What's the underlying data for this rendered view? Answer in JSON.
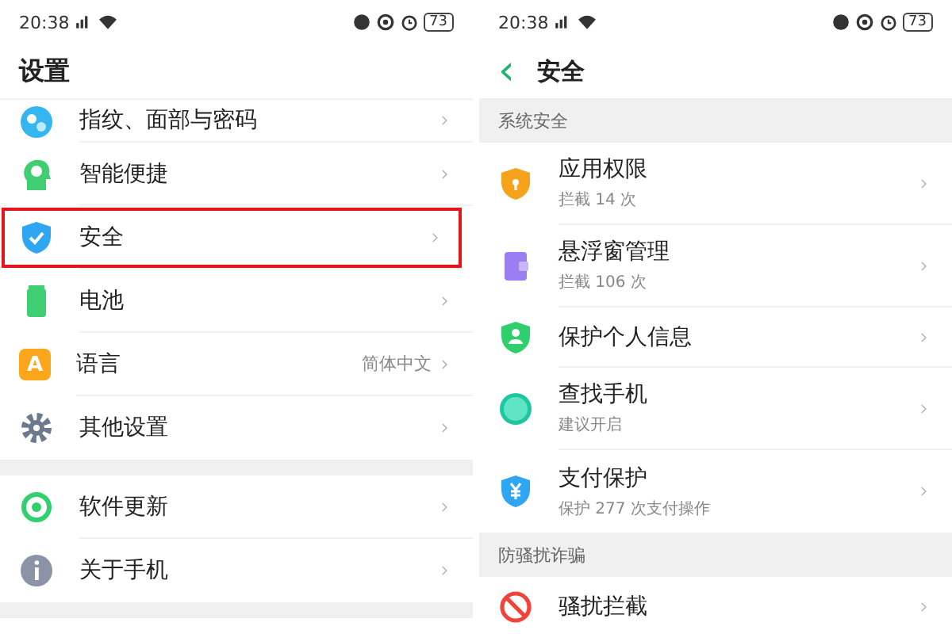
{
  "left_screen": {
    "status_bar": {
      "time": "20:38",
      "battery": "73"
    },
    "title": "设置",
    "groups": [
      {
        "items": [
          {
            "label": "指纹、面部与密码",
            "highlighted": false
          },
          {
            "label": "智能便捷",
            "highlighted": false
          },
          {
            "label": "安全",
            "highlighted": true
          },
          {
            "label": "电池",
            "highlighted": false
          },
          {
            "label": "语言",
            "value": "简体中文",
            "icon_text": "A",
            "highlighted": false
          },
          {
            "label": "其他设置",
            "highlighted": false
          }
        ]
      },
      {
        "items": [
          {
            "label": "软件更新",
            "highlighted": false
          },
          {
            "label": "关于手机",
            "highlighted": false
          }
        ]
      }
    ]
  },
  "right_screen": {
    "status_bar": {
      "time": "20:38",
      "battery": "73"
    },
    "back": "‹",
    "title": "安全",
    "sections": [
      {
        "header": "系统安全",
        "items": [
          {
            "label": "应用权限",
            "subtitle": "拦截 14 次"
          },
          {
            "label": "悬浮窗管理",
            "subtitle": "拦截 106 次"
          },
          {
            "label": "保护个人信息"
          },
          {
            "label": "查找手机",
            "subtitle": "建议开启"
          },
          {
            "label": "支付保护",
            "subtitle": "保护 277 次支付操作"
          }
        ]
      },
      {
        "header": "防骚扰诈骗",
        "items": [
          {
            "label": "骚扰拦截"
          }
        ]
      }
    ]
  }
}
